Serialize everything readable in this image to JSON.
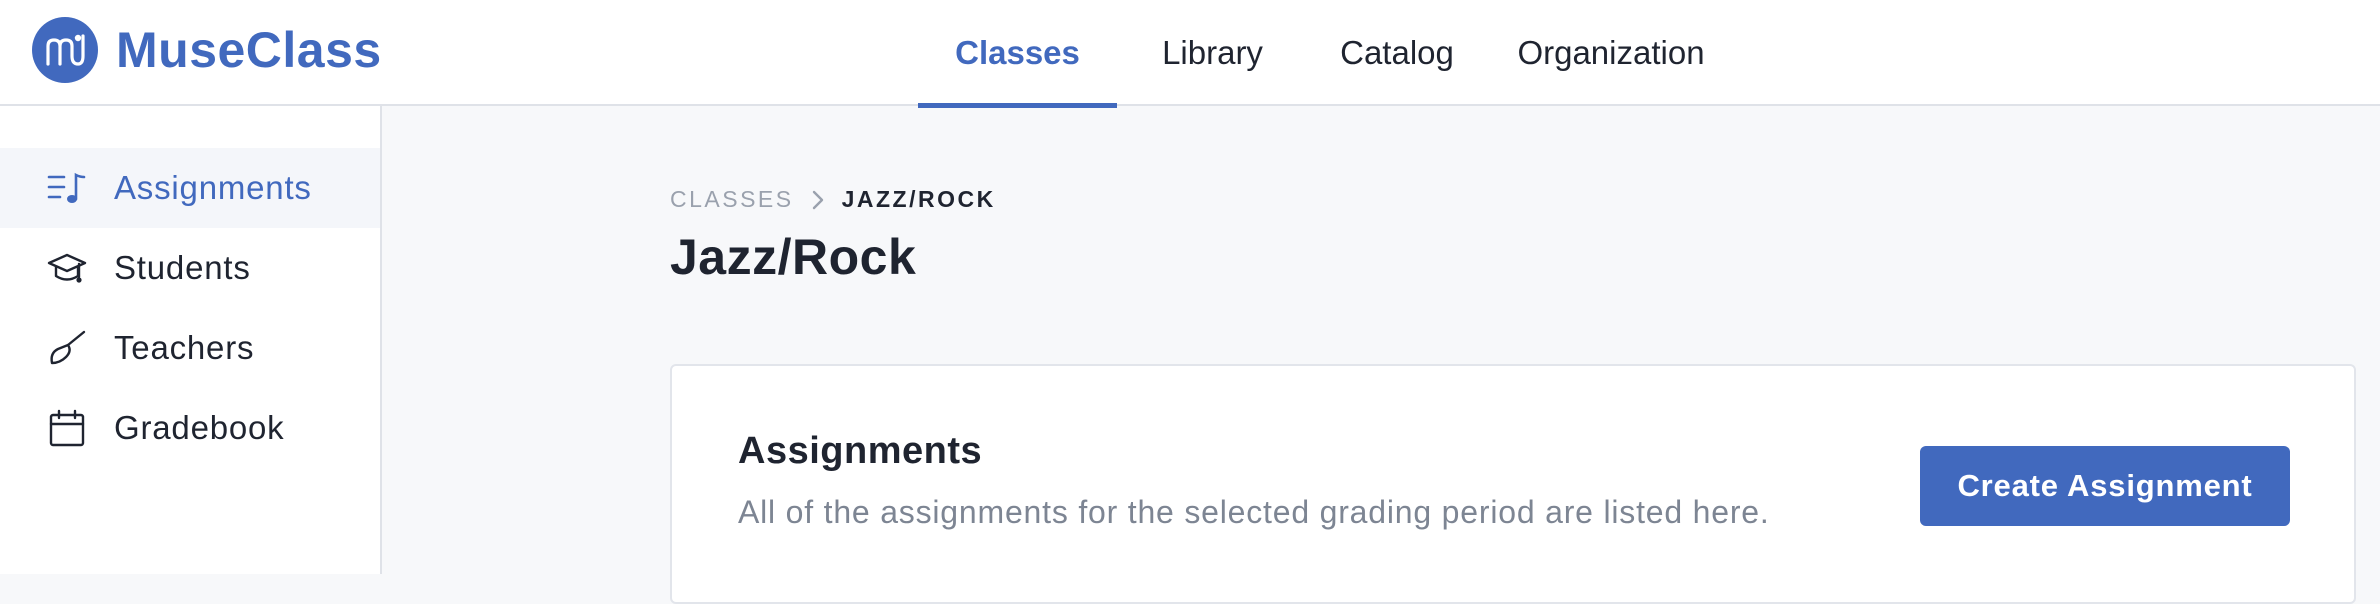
{
  "brand": {
    "name": "MuseClass",
    "color": "#4169be"
  },
  "nav": {
    "tabs": [
      {
        "label": "Classes",
        "active": true
      },
      {
        "label": "Library",
        "active": false
      },
      {
        "label": "Catalog",
        "active": false
      },
      {
        "label": "Organization",
        "active": false
      }
    ]
  },
  "sidebar": {
    "items": [
      {
        "label": "Assignments",
        "icon": "music-list-icon",
        "active": true
      },
      {
        "label": "Students",
        "icon": "graduation-cap-icon",
        "active": false
      },
      {
        "label": "Teachers",
        "icon": "conductor-baton-icon",
        "active": false
      },
      {
        "label": "Gradebook",
        "icon": "calendar-icon",
        "active": false
      }
    ]
  },
  "breadcrumb": {
    "parent": "CLASSES",
    "current": "JAZZ/ROCK"
  },
  "page": {
    "title": "Jazz/Rock"
  },
  "card": {
    "title": "Assignments",
    "description": "All of the assignments for the selected grading period are listed here.",
    "create_button": "Create Assignment"
  }
}
